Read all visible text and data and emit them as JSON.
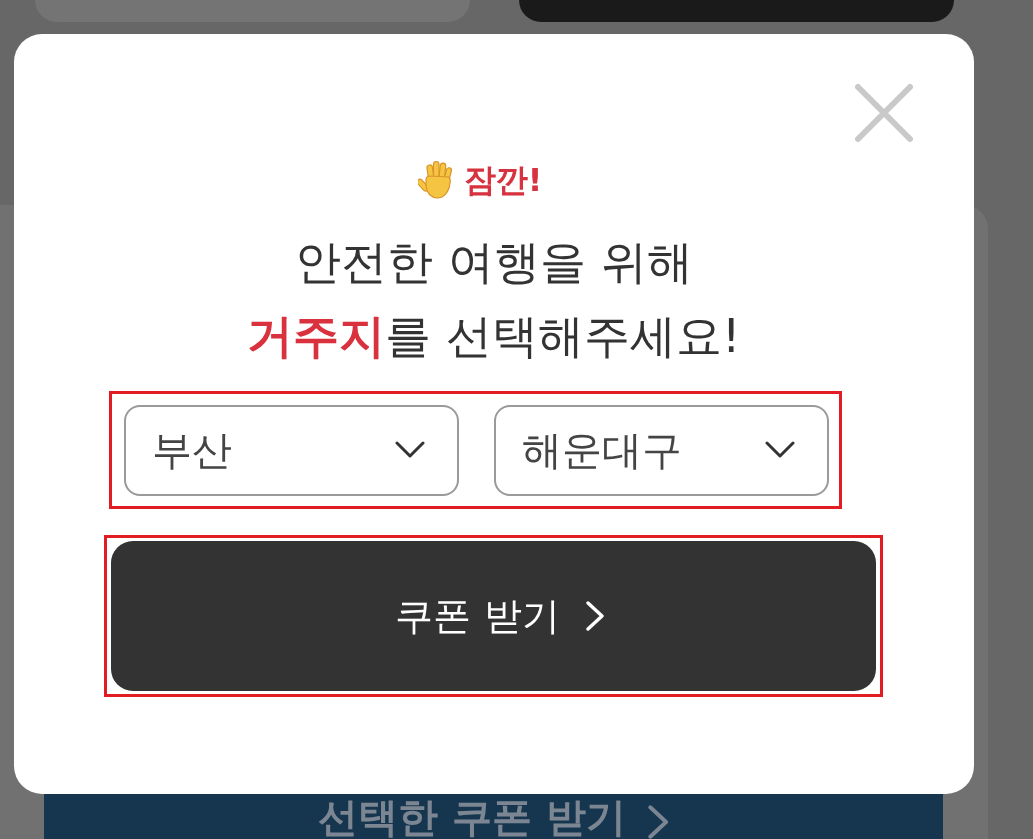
{
  "dialog": {
    "notice": "잠깐!",
    "headline": [
      [
        {
          "text": "안전한 여행을 위해",
          "highlight": false
        }
      ],
      [
        {
          "text": "거주지",
          "highlight": true
        },
        {
          "text": "를 선택해주세요!",
          "highlight": false
        }
      ]
    ],
    "selects": [
      {
        "value": "부산"
      },
      {
        "value": "해운대구"
      }
    ],
    "submit_button": {
      "label": "쿠폰 받기"
    }
  },
  "page_button": {
    "label": "선택한 쿠폰 받기"
  }
}
